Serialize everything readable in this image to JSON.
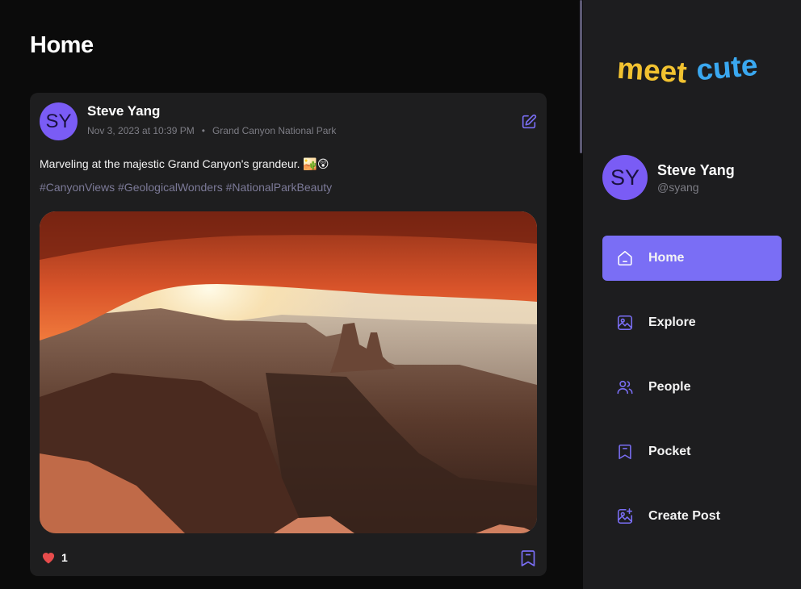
{
  "page": {
    "title": "Home"
  },
  "post": {
    "avatar_initials": "SY",
    "author_name": "Steve Yang",
    "date": "Nov 3, 2023 at 10:39 PM",
    "separator": "•",
    "location": "Grand Canyon National Park",
    "caption": "Marveling at the majestic Grand Canyon's grandeur. 🏜️😲",
    "hashtags": "#CanyonViews #GeologicalWonders #NationalParkBeauty",
    "like_count": "1"
  },
  "sidebar": {
    "logo_text": "meetcute",
    "profile": {
      "avatar_initials": "SY",
      "name": "Steve Yang",
      "handle": "@syang"
    },
    "nav": [
      {
        "label": "Home",
        "icon": "home-icon",
        "active": true
      },
      {
        "label": "Explore",
        "icon": "image-icon",
        "active": false
      },
      {
        "label": "People",
        "icon": "people-icon",
        "active": false
      },
      {
        "label": "Pocket",
        "icon": "bookmark-icon",
        "active": false
      },
      {
        "label": "Create Post",
        "icon": "image-add-icon",
        "active": false
      }
    ]
  },
  "colors": {
    "accent": "#7a6ef5",
    "avatar": "#7a5cf5",
    "like": "#e74c4c",
    "logo_yellow": "#f2c230",
    "logo_blue": "#3aa8f0"
  }
}
